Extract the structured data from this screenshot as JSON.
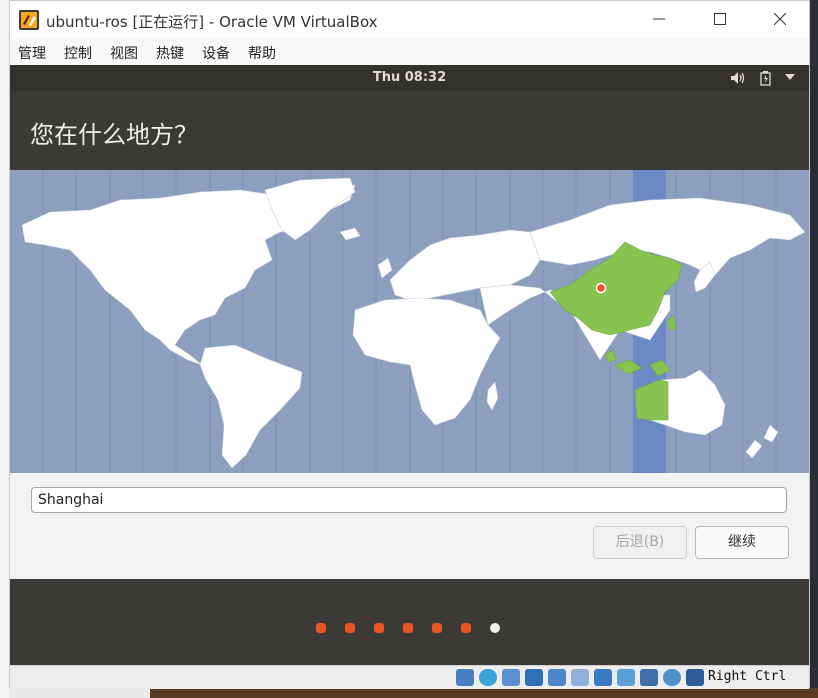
{
  "window": {
    "title": "ubuntu-ros [正在运行] - Oracle VM VirtualBox",
    "controls": [
      "minimize",
      "maximize",
      "close"
    ]
  },
  "menu": {
    "items": [
      "管理",
      "控制",
      "视图",
      "热键",
      "设备",
      "帮助"
    ]
  },
  "guest": {
    "clock": "Thu 08:32",
    "tray_icons": [
      "volume-icon",
      "battery-icon",
      "dropdown-arrow-icon"
    ],
    "heading": "您在什么地方？",
    "location_value": "Shanghai",
    "back_label": "后退(B)",
    "continue_label": "继续",
    "progress": {
      "total_steps": 7,
      "current_step": 7
    }
  },
  "colors": {
    "ocean": "#8c9fbf",
    "land": "#ffffff",
    "selected_region": "#86c44f",
    "timezone_band": "#6b89c4",
    "accent": "#e95420",
    "current_dot": "#eeeeec"
  },
  "statusbar": {
    "host_key": "Right Ctrl"
  }
}
